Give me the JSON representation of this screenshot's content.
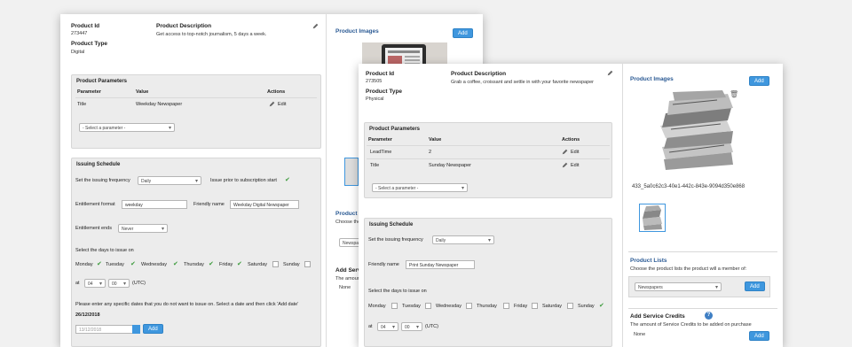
{
  "back": {
    "product_id_label": "Product Id",
    "product_id": "273447",
    "product_type_label": "Product Type",
    "product_type": "Digital",
    "description_label": "Product Description",
    "description": "Get access to top-notch journalism, 5 days a week.",
    "images_label": "Product Images",
    "add_label": "Add",
    "params": {
      "title": "Product Parameters",
      "headers": [
        "Parameter",
        "Value",
        "Actions"
      ],
      "rows": [
        {
          "parameter": "Title",
          "value": "Weekday Newspaper",
          "action": "Edit"
        }
      ],
      "select_placeholder": "- Select a parameter -"
    },
    "schedule": {
      "title": "Issuing Schedule",
      "freq_label": "Set the issuing frequency",
      "freq_value": "Daily",
      "prior_label": "Issue prior to subscription start",
      "ent_format_label": "Entitlement format",
      "ent_format_value": "weekday",
      "friendly_label": "Friendly name",
      "friendly_value": "Weekday Digital Newspaper",
      "ent_ends_label": "Entitlement ends",
      "ent_ends_value": "Never",
      "days_label": "Select the days to issue on",
      "days": [
        "Monday",
        "Tuesday",
        "Wednesday",
        "Thursday",
        "Friday",
        "Saturday",
        "Sunday"
      ],
      "at_label": "at",
      "hour": "04",
      "minute": "00",
      "tz": "(UTC)",
      "exclude_label": "Please enter any specific dates that you do not want to issue on. Select a date and then click 'Add date'",
      "date_value": "26/12/2018",
      "date_input": "13/12/2018",
      "add_label": "Add"
    },
    "side": {
      "lists_label": "Product",
      "lists_help": "Choose the",
      "lists_select": "Newspa",
      "credits_label": "Add Servic",
      "credits_help": "The amount",
      "credits_value": "None"
    }
  },
  "front": {
    "product_id_label": "Product Id",
    "product_id": "273505",
    "product_type_label": "Product Type",
    "product_type": "Physical",
    "description_label": "Product Description",
    "description": "Grab a coffee, croissant and settle in with your favorite newspaper",
    "params": {
      "title": "Product Parameters",
      "headers": [
        "Parameter",
        "Value",
        "Actions"
      ],
      "rows": [
        {
          "parameter": "LeadTime",
          "value": "2",
          "action": "Edit"
        },
        {
          "parameter": "Title",
          "value": "Sunday Newspaper",
          "action": "Edit"
        }
      ],
      "select_placeholder": "- Select a parameter -"
    },
    "schedule": {
      "title": "Issuing Schedule",
      "freq_label": "Set the issuing frequency",
      "freq_value": "Daily",
      "friendly_label": "Friendly name",
      "friendly_value": "Print Sunday Newspaper",
      "days_label": "Select the days to issue on",
      "days": [
        "Monday",
        "Tuesday",
        "Wednesday",
        "Thursday",
        "Friday",
        "Saturday",
        "Sunday"
      ],
      "at_label": "at",
      "hour": "04",
      "minute": "00",
      "tz": "(UTC)"
    },
    "side": {
      "images_label": "Product Images",
      "add_label": "Add",
      "image_id": "433_5a0c62c3-40e1-442c-843e-9094d350e868",
      "lists_label": "Product Lists",
      "lists_help": "Choose the product lists the product will a member of:",
      "lists_select": "Newspapers",
      "lists_add": "Add",
      "credits_label": "Add Service Credits",
      "credits_help": "The amount of Service Credits to be added on purchase",
      "credits_value": "None",
      "credits_add": "Add"
    }
  }
}
